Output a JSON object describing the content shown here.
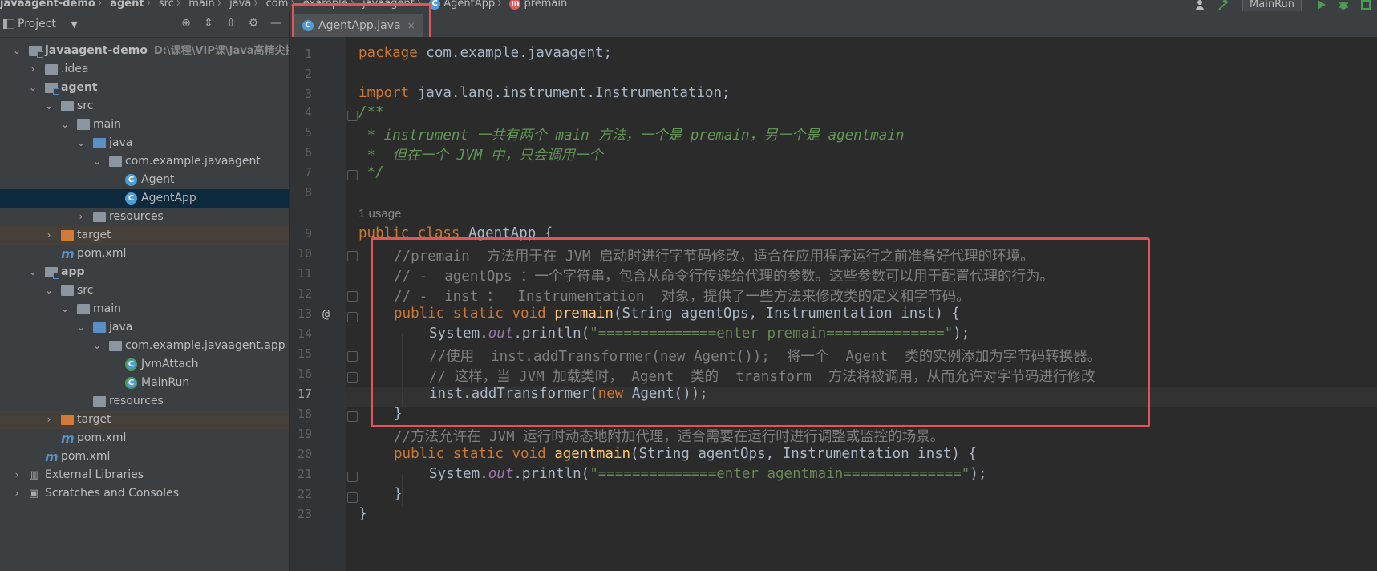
{
  "breadcrumbs": [
    "javaagent-demo",
    "agent",
    "src",
    "main",
    "java",
    "com",
    "example",
    "javaagent",
    "AgentApp",
    "premain"
  ],
  "run_config": "MainRun",
  "project_panel": {
    "title": "Project"
  },
  "tree": [
    {
      "label": "javaagent-demo",
      "path": "D:\\课程\\VIP课\\Java高精尖技术"
    },
    {
      "label": ".idea"
    },
    {
      "label": "agent"
    },
    {
      "label": "src"
    },
    {
      "label": "main"
    },
    {
      "label": "java"
    },
    {
      "label": "com.example.javaagent"
    },
    {
      "label": "Agent"
    },
    {
      "label": "AgentApp"
    },
    {
      "label": "resources"
    },
    {
      "label": "target"
    },
    {
      "label": "pom.xml"
    },
    {
      "label": "app"
    },
    {
      "label": "src"
    },
    {
      "label": "main"
    },
    {
      "label": "java"
    },
    {
      "label": "com.example.javaagent.app"
    },
    {
      "label": "JvmAttach"
    },
    {
      "label": "MainRun"
    },
    {
      "label": "resources"
    },
    {
      "label": "target"
    },
    {
      "label": "pom.xml"
    },
    {
      "label": "pom.xml"
    },
    {
      "label": "External Libraries"
    },
    {
      "label": "Scratches and Consoles"
    }
  ],
  "tab": {
    "label": "AgentApp.java"
  },
  "usage_hint": "1 usage",
  "line_numbers": [
    "1",
    "2",
    "3",
    "4",
    "5",
    "6",
    "7",
    "8",
    "9",
    "10",
    "11",
    "12",
    "13",
    "14",
    "15",
    "16",
    "17",
    "18",
    "19",
    "20",
    "21",
    "22",
    "23"
  ],
  "code": {
    "l1_kw": "package",
    "l1_rest": " com.example.javaagent;",
    "l3_kw": "import",
    "l3_rest": " java.lang.instrument.Instrumentation;",
    "l4": "/**",
    "l5": " * instrument 一共有两个 main 方法，一个是 premain，另一个是 agentmain",
    "l6": " *  但在一个 JVM 中，只会调用一个",
    "l7": " */",
    "l9_kw": "public class",
    "l9_rest": " AgentApp {",
    "l10": "//premain  方法用于在 JVM 启动时进行字节码修改，适合在应用程序运行之前准备好代理的环境。",
    "l11": "// -  agentOps ：一个字符串，包含从命令行传递给代理的参数。这些参数可以用于配置代理的行为。",
    "l12": "// -  inst ：  Instrumentation  对象，提供了一些方法来修改类的定义和字节码。",
    "l13_kw": "public static void",
    "l13_fn": "premain",
    "l13_rest": "(String agentOps, Instrumentation inst) {",
    "l14_a": "System.",
    "l14_b": "out",
    "l14_c": ".println(",
    "l14_s": "\"==============enter premain==============\"",
    "l14_d": ");",
    "l15": "//使用  inst.addTransformer(new Agent());  将一个  Agent  类的实例添加为字节码转换器。",
    "l16": "// 这样，当 JVM 加载类时， Agent  类的  transform  方法将被调用，从而允许对字节码进行修改",
    "l17_a": "inst.addTransformer(",
    "l17_kw": "new",
    "l17_b": " Agent());",
    "l18": "}",
    "l19": "//方法允许在 JVM 运行时动态地附加代理，适合需要在运行时进行调整或监控的场景。",
    "l20_kw": "public static void",
    "l20_fn": "agentmain",
    "l20_rest": "(String agentOps, Instrumentation inst) {",
    "l21_a": "System.",
    "l21_b": "out",
    "l21_c": ".println(",
    "l21_s": "\"==============enter agentmain==============\"",
    "l21_d": ");",
    "l22": "}",
    "l23": "}"
  },
  "gutter_marker": "@",
  "colors": {
    "highlight_box": "#e0555a",
    "selection": "#0d293e",
    "accent": "#4a88c7"
  }
}
